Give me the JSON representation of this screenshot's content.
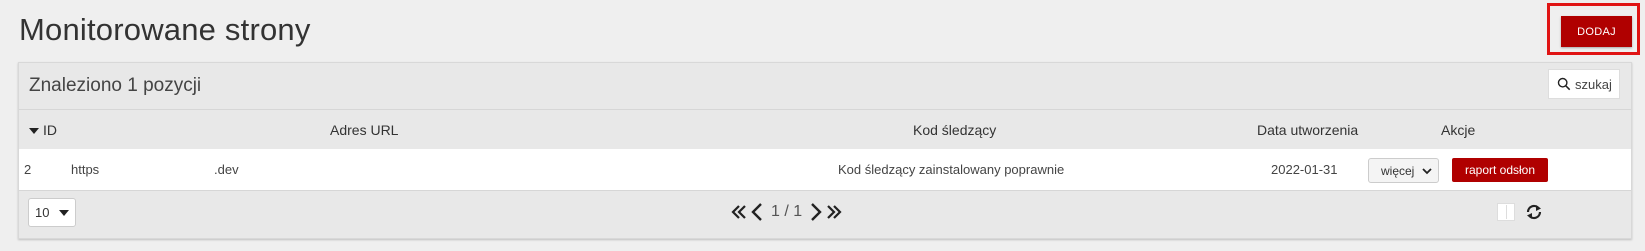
{
  "page": {
    "title": "Monitorowane strony",
    "add_label": "DODAJ"
  },
  "panel": {
    "found_text": "Znaleziono 1 pozycji",
    "search_placeholder": "szukaj"
  },
  "table": {
    "columns": [
      "ID",
      "Adres URL",
      "Kod śledzący",
      "Data utworzenia",
      "Akcje"
    ],
    "rows": [
      {
        "id": "2",
        "url_prefix": "https",
        "url_suffix": ".dev",
        "tracking": "Kod śledzący zainstalowany poprawnie",
        "created": "2022-01-31",
        "more_label": "więcej",
        "report_label": "raport odsłon"
      }
    ]
  },
  "footer": {
    "page_size": "10",
    "current_page": "1",
    "total_pages": "1",
    "separator": "/"
  }
}
